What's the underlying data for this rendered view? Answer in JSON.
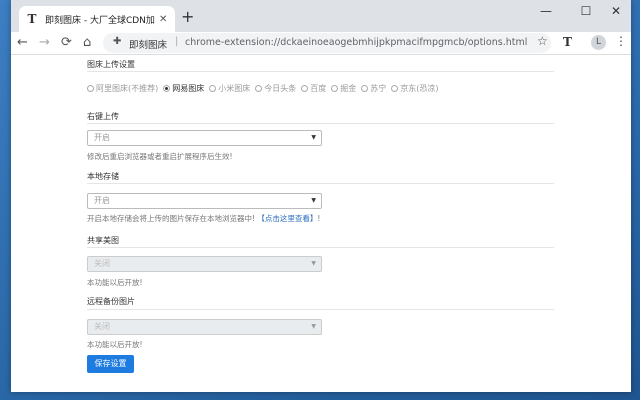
{
  "browser": {
    "tab_title": "即刻图床 - 大厂全球CDN加速免",
    "tab_favicon": "T",
    "new_tab": "+",
    "controls": {
      "minimize": "—",
      "maximize": "☐",
      "close": "✕"
    },
    "nav": {
      "back": "←",
      "forward": "→",
      "reload": "⟳",
      "home": "⌂"
    },
    "omnibox": {
      "extension_name": "即刻图床",
      "url": "chrome-extension://dckaeinoeaogebmhijpkpmacifmpgmcb/options.html"
    },
    "extension_icon": "T",
    "profile_initial": "L",
    "menu": "⋮",
    "star": "☆"
  },
  "settings": {
    "upload_section": {
      "title": "图床上传设置",
      "options": [
        {
          "label": "阿里图床(不推荐)",
          "checked": false
        },
        {
          "label": "网易图床",
          "checked": true
        },
        {
          "label": "小米图床",
          "checked": false
        },
        {
          "label": "今日头条",
          "checked": false
        },
        {
          "label": "百度",
          "checked": false
        },
        {
          "label": "掘金",
          "checked": false
        },
        {
          "label": "苏宁",
          "checked": false
        },
        {
          "label": "京东(恐凉)",
          "checked": false
        }
      ]
    },
    "context_upload": {
      "title": "右键上传",
      "value": "开启",
      "hint": "修改后重启浏览器或者重启扩展程序后生效!"
    },
    "local_storage": {
      "title": "本地存储",
      "value": "开启",
      "hint_prefix": "开启本地存储会将上传的图片保存在本地浏览器中!",
      "hint_link": "【点击这里查看】",
      "hint_suffix": "!"
    },
    "share_category": {
      "title": "共享美图",
      "value": "关闭",
      "hint": "本功能以后开放!"
    },
    "remote_backup": {
      "title": "远程备份图片",
      "value": "关闭",
      "hint": "本功能以后开放!"
    },
    "save_button": "保存设置"
  },
  "colors": {
    "accent": "#1e7be0",
    "link": "#2a6ebd"
  }
}
